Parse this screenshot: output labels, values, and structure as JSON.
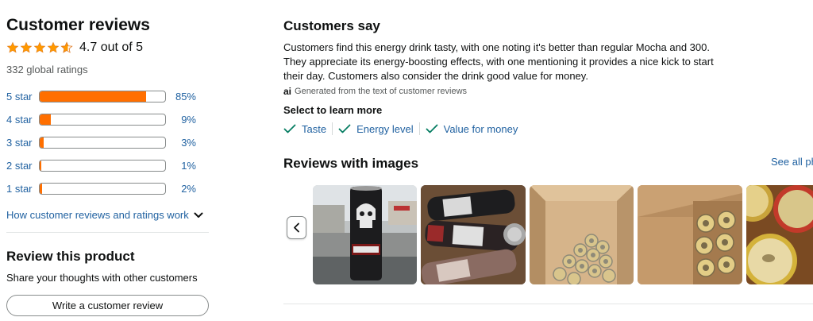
{
  "reviews": {
    "title": "Customer reviews",
    "rating_text": "4.7 out of 5",
    "rating_value": 4.7,
    "global_ratings": "332 global ratings",
    "histogram": [
      {
        "label": "5 star",
        "percent": "85%",
        "value": 85
      },
      {
        "label": "4 star",
        "percent": "9%",
        "value": 9
      },
      {
        "label": "3 star",
        "percent": "3%",
        "value": 3
      },
      {
        "label": "2 star",
        "percent": "1%",
        "value": 1
      },
      {
        "label": "1 star",
        "percent": "2%",
        "value": 2
      }
    ],
    "how_link": "How customer reviews and ratings work"
  },
  "review_product": {
    "title": "Review this product",
    "subtitle": "Share your thoughts with other customers",
    "button": "Write a customer review"
  },
  "customers_say": {
    "title": "Customers say",
    "summary": "Customers find this energy drink tasty, with one noting it's better than regular Mocha and 300. They appreciate its energy-boosting effects, with one mentioning it provides a nice kick to start their day. Customers also consider the drink good value for money.",
    "ai_badge": "ai",
    "ai_note": "Generated from the text of customer reviews",
    "learn_more": "Select to learn more",
    "aspects": [
      "Taste",
      "Energy level",
      "Value for money"
    ]
  },
  "reviews_with_images": {
    "title": "Reviews with images",
    "see_all": "See all ph"
  },
  "colors": {
    "star": "#ff9900",
    "bar_fill": "#ff6f00",
    "link": "#2162a1",
    "check": "#067d62"
  },
  "icons": {
    "star": "star-icon",
    "chevron": "chevron-down-icon",
    "check": "checkmark-icon",
    "prev": "chevron-left-icon"
  }
}
